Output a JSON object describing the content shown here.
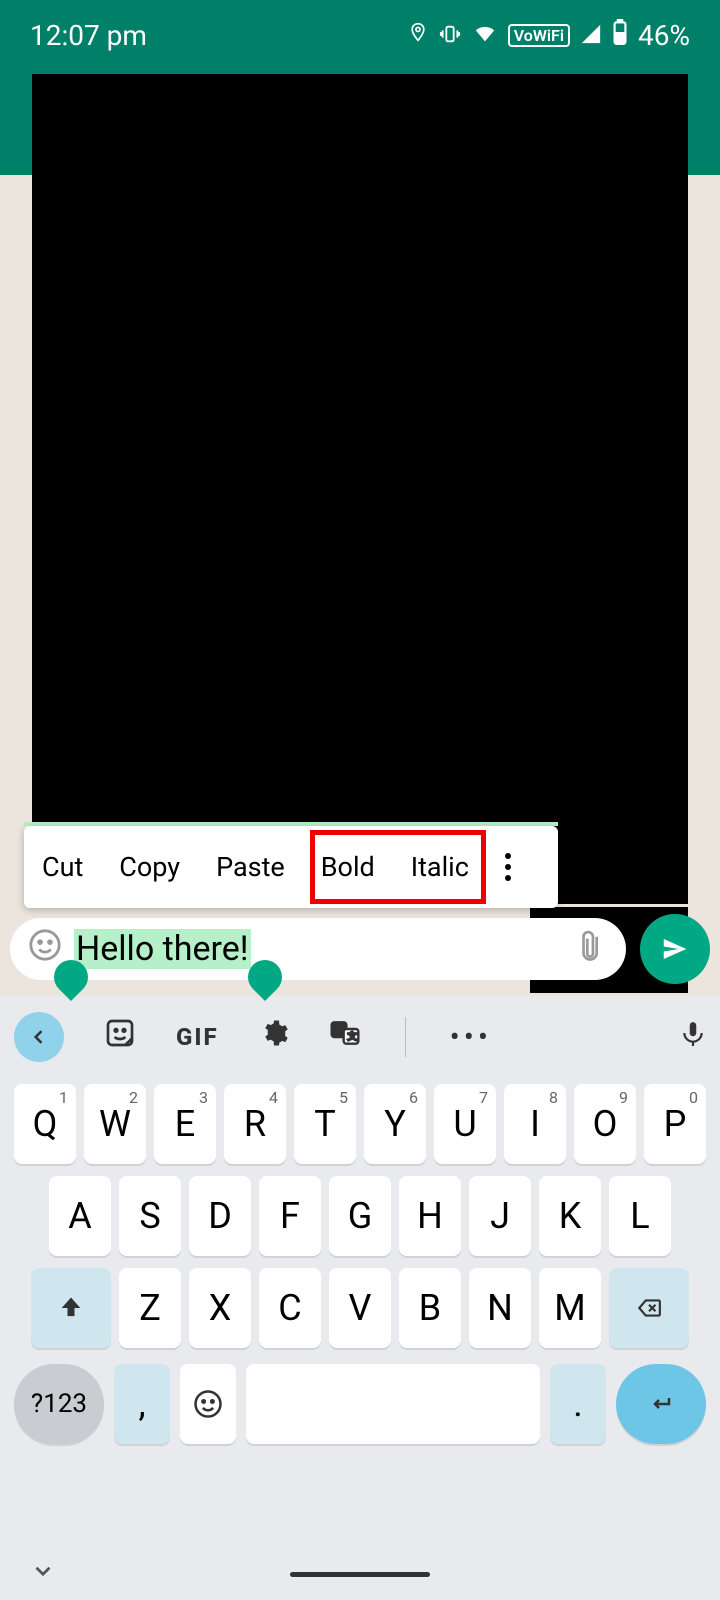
{
  "status": {
    "time": "12:07 pm",
    "vowifi": "VoWiFi",
    "battery": "46%"
  },
  "context_menu": {
    "cut": "Cut",
    "copy": "Copy",
    "paste": "Paste",
    "bold": "Bold",
    "italic": "Italic"
  },
  "input": {
    "text": "Hello there!"
  },
  "keyboard": {
    "gif": "GIF",
    "row1": [
      {
        "k": "Q",
        "n": "1"
      },
      {
        "k": "W",
        "n": "2"
      },
      {
        "k": "E",
        "n": "3"
      },
      {
        "k": "R",
        "n": "4"
      },
      {
        "k": "T",
        "n": "5"
      },
      {
        "k": "Y",
        "n": "6"
      },
      {
        "k": "U",
        "n": "7"
      },
      {
        "k": "I",
        "n": "8"
      },
      {
        "k": "O",
        "n": "9"
      },
      {
        "k": "P",
        "n": "0"
      }
    ],
    "row2": [
      "A",
      "S",
      "D",
      "F",
      "G",
      "H",
      "J",
      "K",
      "L"
    ],
    "row3": [
      "Z",
      "X",
      "C",
      "V",
      "B",
      "N",
      "M"
    ],
    "numkey": "?123",
    "comma": ",",
    "period": "."
  }
}
